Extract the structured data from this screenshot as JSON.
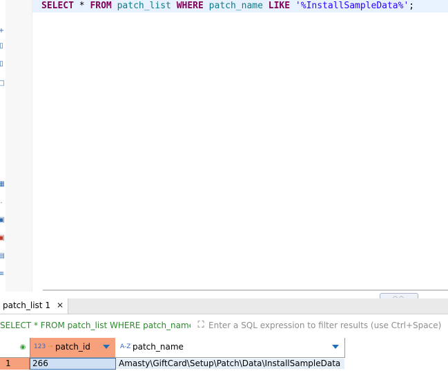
{
  "editor": {
    "sql_tokens": [
      {
        "text": "SELECT",
        "kind": "kw"
      },
      {
        "text": " * ",
        "kind": "op"
      },
      {
        "text": "FROM",
        "kind": "kw"
      },
      {
        "text": " ",
        "kind": "op"
      },
      {
        "text": "patch_list",
        "kind": "ident"
      },
      {
        "text": " ",
        "kind": "op"
      },
      {
        "text": "WHERE",
        "kind": "kw"
      },
      {
        "text": " ",
        "kind": "op"
      },
      {
        "text": "patch_name",
        "kind": "ident"
      },
      {
        "text": " ",
        "kind": "op"
      },
      {
        "text": "LIKE",
        "kind": "kw"
      },
      {
        "text": " ",
        "kind": "op"
      },
      {
        "text": "'%InstallSampleData%'",
        "kind": "str"
      },
      {
        "text": ";",
        "kind": "op"
      }
    ]
  },
  "results_tab": {
    "label": "patch_list 1",
    "close_glyph": "✕"
  },
  "filter": {
    "query_text": "SELECT * FROM patch_list WHERE patch_name LIKE '%InstallSampleData%'",
    "placeholder": "Enter a SQL expression to filter results (use Ctrl+Space)"
  },
  "grid": {
    "columns": [
      {
        "label": "patch_id",
        "type_glyph": "123"
      },
      {
        "label": "patch_name",
        "type_glyph": "A-Z"
      }
    ],
    "rows": [
      {
        "num": "1",
        "cells": [
          "266",
          "Amasty\\GiftCard\\Setup\\Patch\\Data\\InstallSampleData"
        ]
      }
    ]
  },
  "colors": {
    "keyword": "#7f0055",
    "identifier": "#0b7b8a",
    "string": "#2a00ff",
    "selected_column": "#f6a07c",
    "filter_sql": "#2b8a2b"
  }
}
